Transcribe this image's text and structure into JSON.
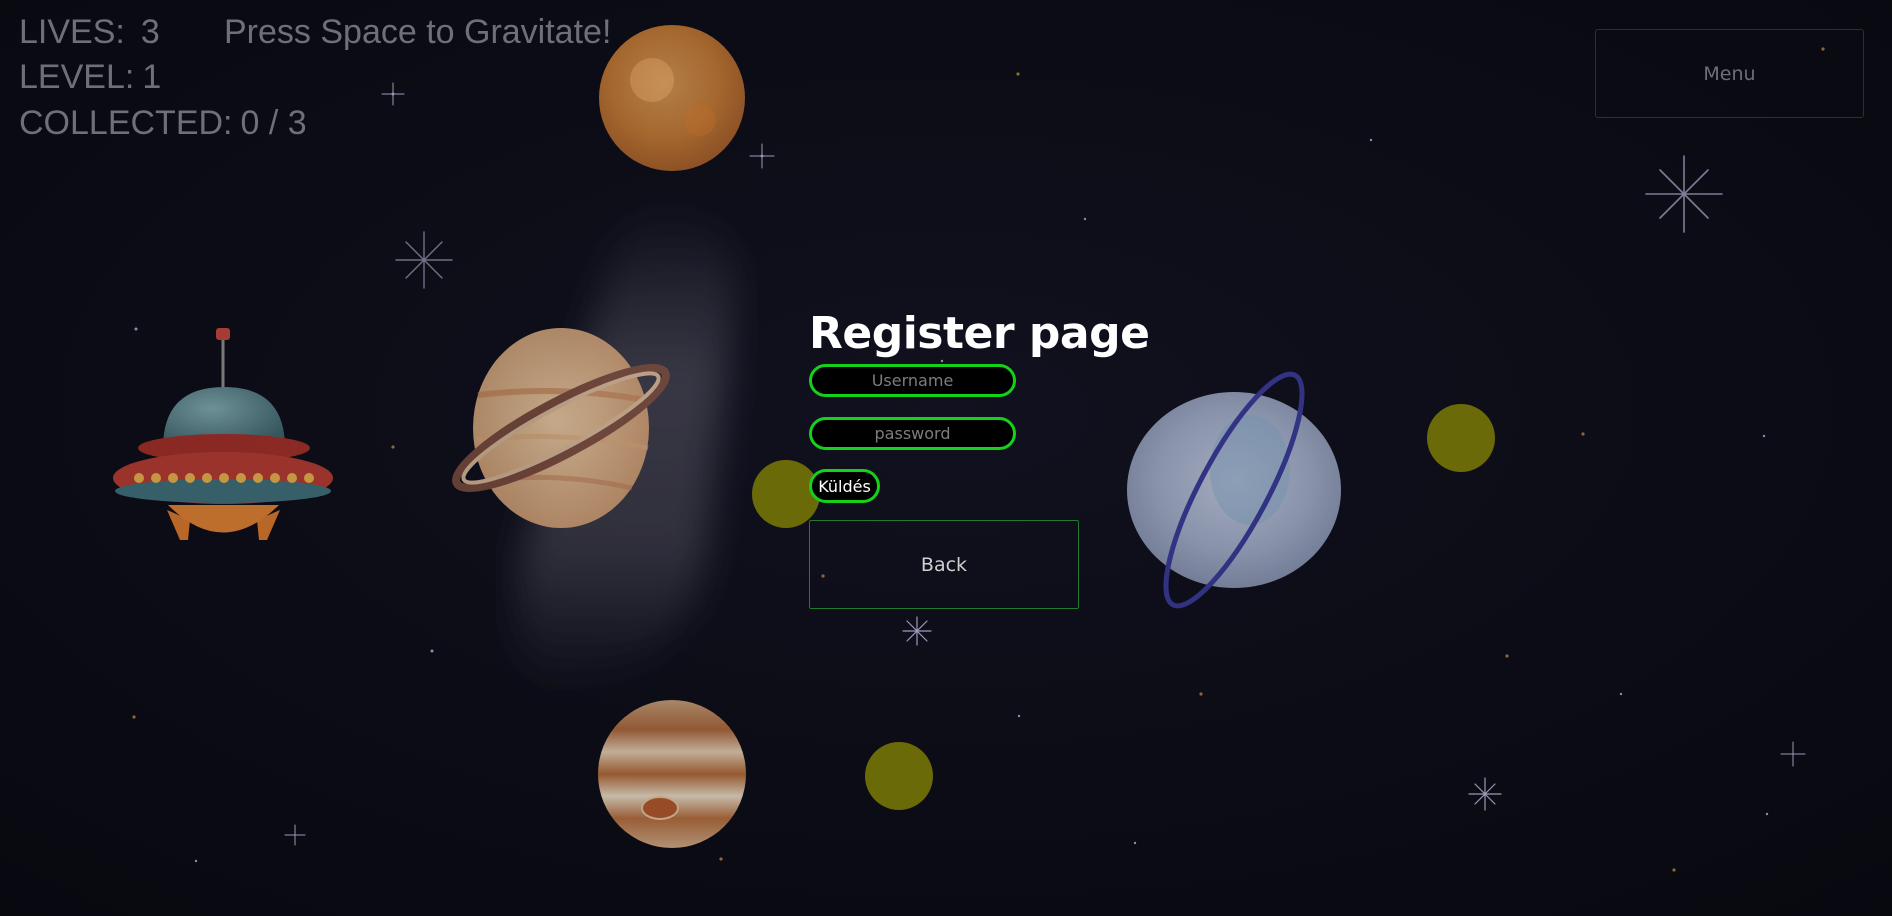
{
  "hud": {
    "lives_label": "LIVES:",
    "lives_value": "3",
    "hint": "Press Space to Gravitate!",
    "level_label": "LEVEL:",
    "level_value": "1",
    "collected_label": "COLLECTED:",
    "collected_value": "0 / 3"
  },
  "menu": {
    "label": "Menu"
  },
  "register": {
    "title": "Register page",
    "username_placeholder": "Username",
    "password_placeholder": "password",
    "submit_label": "Küldés",
    "back_label": "Back"
  },
  "game": {
    "collectibles_total": 3,
    "collectibles_collected": 0,
    "colors": {
      "background": "#0b0b16",
      "accent_green": "#14d11a",
      "collectible": "#6b6a08",
      "hud_text": "#6f6f78"
    }
  }
}
